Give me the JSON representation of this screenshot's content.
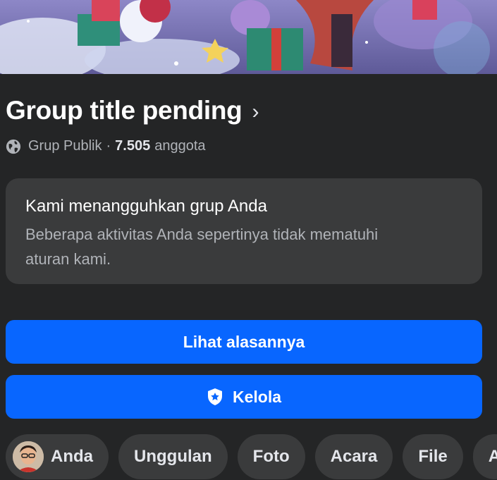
{
  "group": {
    "title": "Group title pending",
    "chevron": "›",
    "privacy_icon": "globe-icon",
    "privacy": "Grup Publik",
    "separator": "·",
    "member_count": "7.505",
    "member_label": "anggota"
  },
  "notice": {
    "title": "Kami menangguhkan grup Anda",
    "body_line1": "Beberapa aktivitas Anda sepertinya tidak mematuhi",
    "body_line2": "aturan kami."
  },
  "actions": {
    "reason_label": "Lihat alasannya",
    "manage_icon": "shield-star-icon",
    "manage_label": "Kelola"
  },
  "tabs": [
    {
      "label": "Anda"
    },
    {
      "label": "Unggulan"
    },
    {
      "label": "Foto"
    },
    {
      "label": "Acara"
    },
    {
      "label": "File"
    },
    {
      "label": "A"
    }
  ],
  "colors": {
    "background": "#242526",
    "card": "#3a3b3c",
    "primary_button": "#0866ff",
    "secondary_text": "#b0b3b8"
  }
}
